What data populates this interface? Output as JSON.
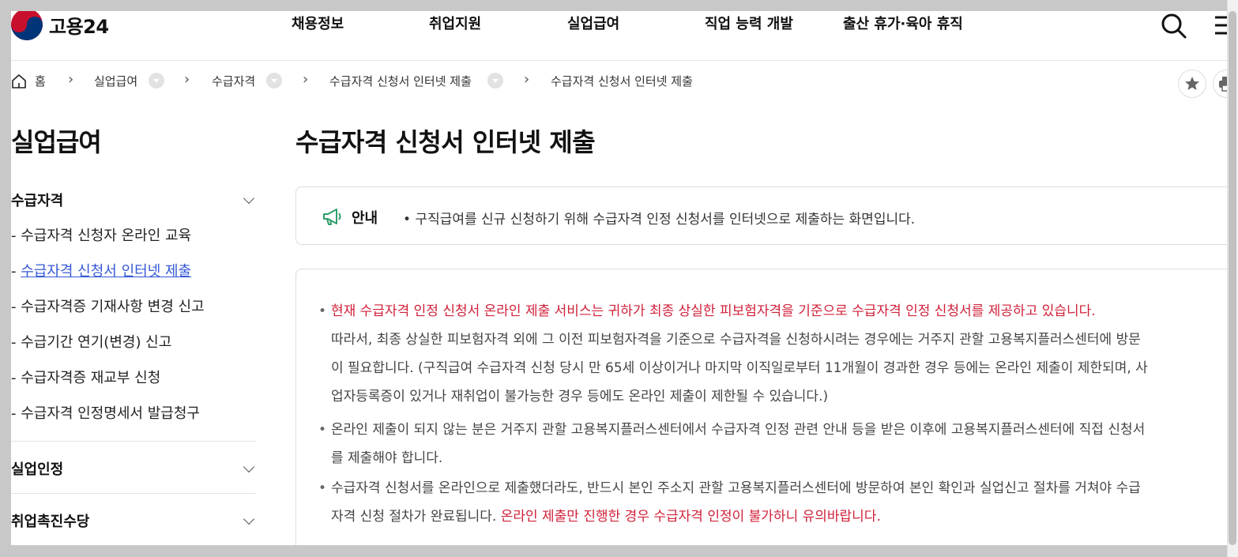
{
  "brand": {
    "logo_text": "고용24"
  },
  "gnb": [
    "채용정보",
    "취업지원",
    "실업급여",
    "직업 능력 개발",
    "출산 휴가·육아 휴직"
  ],
  "breadcrumb": {
    "home": "홈",
    "items": [
      "실업급여",
      "수급자격",
      "수급자격 신청서 인터넷 제출",
      "수급자격 신청서 인터넷 제출"
    ]
  },
  "sidebar": {
    "title": "실업급여",
    "groups": [
      {
        "label": "수급자격",
        "items": [
          "- 수급자격 신청자 온라인 교육",
          "수급자격 신청서 인터넷 제출",
          "- 수급자격증 기재사항 변경 신고",
          "- 수급기간 연기(변경) 신고",
          "- 수급자격증 재교부 신청",
          "- 수급자격 인정명세서 발급청구"
        ],
        "active_prefix": "- "
      },
      {
        "label": "실업인정"
      },
      {
        "label": "취업촉진수당"
      }
    ]
  },
  "main": {
    "title": "수급자격 신청서 인터넷 제출",
    "notice": {
      "label": "안내",
      "text": "• 구직급여를 신규 신청하기 위해 수급자격 인정 신청서를 인터넷으로 제출하는 화면입니다."
    },
    "content": {
      "p1_red": "현재 수급자격 인정 신청서 온라인 제출 서비스는 귀하가 최종 상실한 피보험자격을 기준으로 수급자격 인정 신청서를 제공하고 있습니다.",
      "p1_line1": "따라서, 최종 상실한 피보험자격 외에 그 이전 피보험자격을 기준으로 수급자격을 신청하시려는 경우에는 거주지 관할 고용복지플러스센터에 방문",
      "p1_line2": "이 필요합니다. (구직급여 수급자격 신청 당시 만 65세 이상이거나 마지막 이직일로부터 11개월이 경과한 경우 등에는 온라인 제출이 제한되며, 사",
      "p1_line3": "업자등록증이 있거나 재취업이 불가능한 경우 등에도 온라인 제출이 제한될 수 있습니다.)",
      "p2_line1": "온라인 제출이 되지 않는 분은 거주지 관할 고용복지플러스센터에서 수급자격 인정 관련 안내 등을 받은 이후에 고용복지플러스센터에 직접 신청서",
      "p2_line2": "를 제출해야 합니다.",
      "p3_line1": "수급자격 신청서를 온라인으로 제출했더라도, 반드시 본인 주소지 관할 고용복지플러스센터에 방문하여 본인 확인과 실업신고 절차를 거쳐야 수급",
      "p3_line2_plain": "자격 신청 절차가 완료됩니다.",
      "p3_line2_red": "온라인 제출만 진행한 경우 수급자격 인정이 불가하니 유의바랍니다."
    }
  },
  "colors": {
    "red": "#d0213a",
    "link": "#3558d6",
    "notice_icon": "#2e9e6a"
  },
  "icons": [
    "search-icon",
    "menu-icon",
    "home-icon",
    "star-icon",
    "print-icon",
    "megaphone-icon",
    "chevron-down-icon"
  ]
}
